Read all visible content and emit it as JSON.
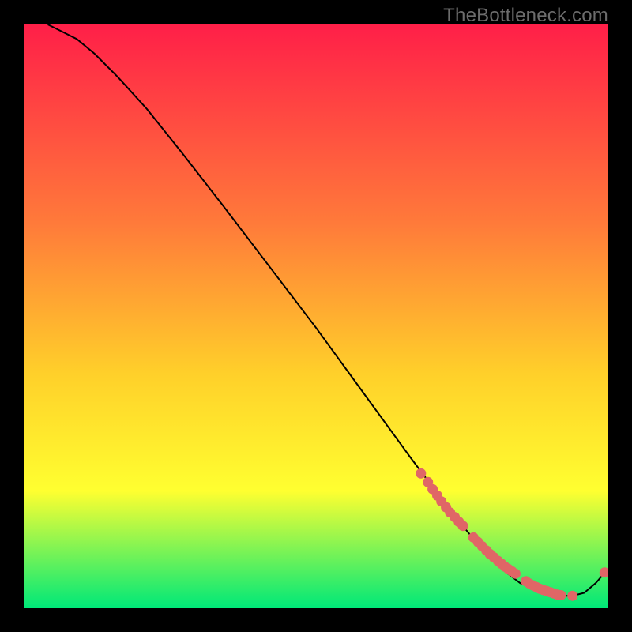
{
  "watermark": "TheBottleneck.com",
  "colors": {
    "gradient_top": "#ff1f48",
    "gradient_mid_upper": "#ff7a3a",
    "gradient_mid": "#ffd02a",
    "gradient_mid_lower": "#ffff30",
    "gradient_bottom": "#00e878",
    "curve": "#000000",
    "dot": "#e06666",
    "background": "#000000"
  },
  "chart_data": {
    "type": "line",
    "title": "",
    "xlabel": "",
    "ylabel": "",
    "xlim": [
      0,
      100
    ],
    "ylim": [
      0,
      100
    ],
    "curve": {
      "x": [
        4,
        6,
        9,
        12,
        16,
        21,
        27,
        34,
        42,
        50,
        58,
        66,
        72,
        76,
        79,
        82,
        85,
        88,
        91,
        94,
        96,
        98,
        100
      ],
      "y": [
        100,
        99,
        97.5,
        95,
        91,
        85.5,
        78,
        69,
        58.5,
        48,
        37,
        26,
        18,
        13,
        9.5,
        6.5,
        4.2,
        2.8,
        2.0,
        2.0,
        2.5,
        4.2,
        6.5
      ]
    },
    "dots": {
      "x": [
        68,
        69.2,
        70,
        70.8,
        71.5,
        72.3,
        73,
        73.8,
        74.5,
        75.2,
        77,
        77.8,
        78.5,
        79.2,
        79.8,
        80.5,
        81.2,
        81.8,
        82.4,
        83,
        83.6,
        84.2,
        86,
        86.6,
        87.2,
        87.8,
        88.4,
        89,
        89.6,
        90.2,
        90.8,
        91.4,
        92,
        94,
        99.5
      ],
      "y": [
        23,
        21.5,
        20.3,
        19.2,
        18.2,
        17.2,
        16.3,
        15.5,
        14.7,
        14.0,
        12.0,
        11.2,
        10.5,
        9.8,
        9.2,
        8.6,
        8.0,
        7.5,
        7.0,
        6.6,
        6.2,
        5.8,
        4.5,
        4.1,
        3.8,
        3.5,
        3.2,
        3.0,
        2.8,
        2.6,
        2.4,
        2.2,
        2.1,
        2.0,
        6.0
      ]
    },
    "annotations": [],
    "legend": null
  }
}
